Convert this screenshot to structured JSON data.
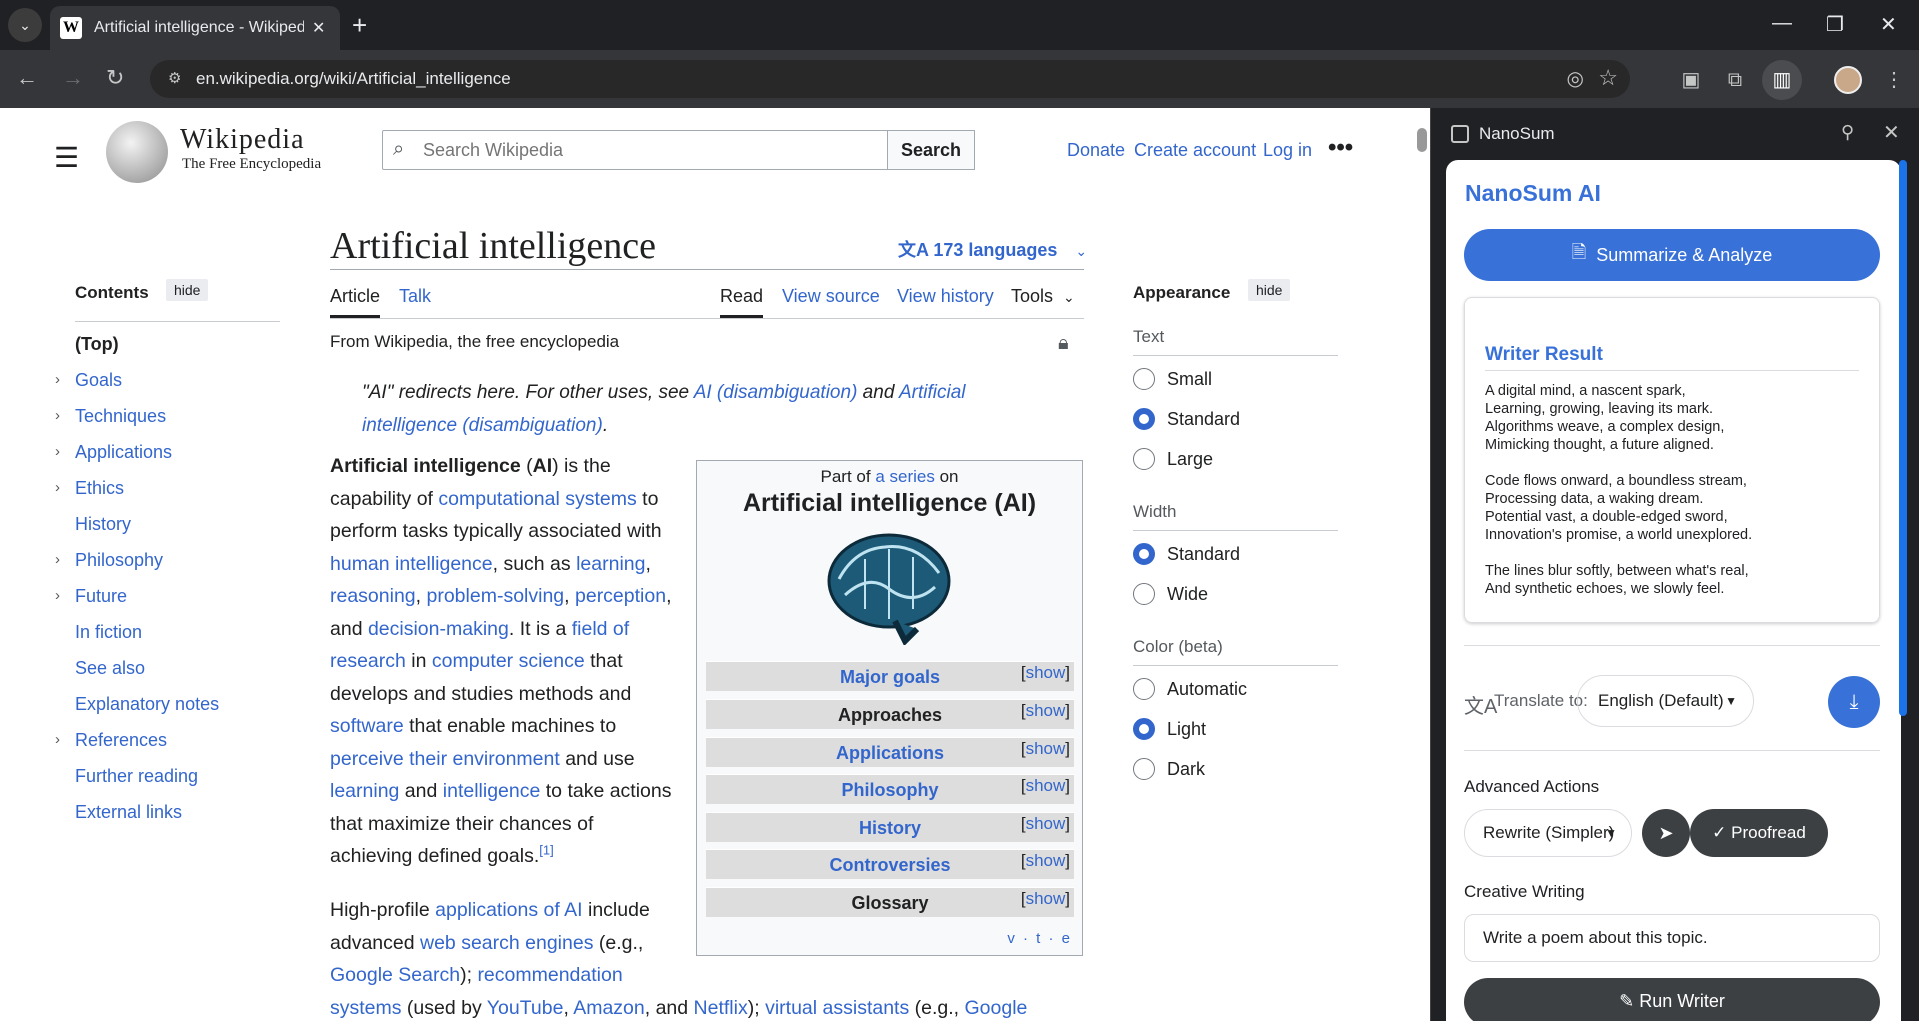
{
  "browser": {
    "tab_title": "Artificial intelligence - Wikipedia",
    "url": "en.wikipedia.org/wiki/Artificial_intelligence"
  },
  "wiki": {
    "wordmark": "Wikipedia",
    "tagline": "The Free Encyclopedia",
    "search_placeholder": "Search Wikipedia",
    "search_button": "Search",
    "donate": "Donate",
    "create_account": "Create account",
    "login": "Log in",
    "toc": {
      "heading": "Contents",
      "hide": "hide",
      "items": [
        "(Top)",
        "Goals",
        "Techniques",
        "Applications",
        "Ethics",
        "History",
        "Philosophy",
        "Future",
        "In fiction",
        "See also",
        "Explanatory notes",
        "References",
        "Further reading",
        "External links"
      ]
    },
    "title": "Artificial intelligence",
    "languages": "173 languages",
    "tabs": {
      "article": "Article",
      "talk": "Talk",
      "read": "Read",
      "view_source": "View source",
      "view_history": "View history",
      "tools": "Tools"
    },
    "from": "From Wikipedia, the free encyclopedia",
    "hatnote": {
      "a": "\"AI\" redirects here. For other uses, see ",
      "link1": "AI (disambiguation)",
      "b": " and ",
      "link2": "Artificial intelligence (disambiguation)",
      "c": "."
    },
    "infobox": {
      "part_of": "Part of ",
      "series": "a series",
      "on": " on",
      "title": "Artificial intelligence (AI)",
      "show": "show",
      "rows": [
        "Major goals",
        "Approaches",
        "Applications",
        "Philosophy",
        "History",
        "Controversies",
        "Glossary"
      ],
      "vte": "v · t · e"
    },
    "appearance": {
      "heading": "Appearance",
      "hide": "hide",
      "text_label": "Text",
      "text_options": [
        "Small",
        "Standard",
        "Large"
      ],
      "width_label": "Width",
      "width_options": [
        "Standard",
        "Wide"
      ],
      "color_label": "Color (beta)",
      "color_options": [
        "Automatic",
        "Light",
        "Dark"
      ]
    }
  },
  "panel": {
    "name": "NanoSum",
    "title": "NanoSum AI",
    "summarize_button": "Summarize & Analyze",
    "result_title": "Writer Result",
    "poem_lines": [
      "A digital mind, a nascent spark,",
      "Learning, growing, leaving its mark.",
      "Algorithms weave, a complex design,",
      "Mimicking thought, a future aligned.",
      "",
      "Code flows onward, a boundless stream,",
      "Processing data, a waking dream.",
      "Potential vast, a double-edged sword,",
      "Innovation's promise, a world unexplored.",
      "",
      "The lines blur softly, between what's real,",
      "And synthetic echoes, we slowly feel."
    ],
    "translate_label": "Translate to:",
    "translate_value": "English (Default)",
    "advanced_label": "Advanced Actions",
    "rewrite_value": "Rewrite (Simpler)",
    "proofread_button": "Proofread",
    "creative_label": "Creative Writing",
    "creative_value": "Write a poem about this topic.",
    "run_button": "Run Writer"
  }
}
